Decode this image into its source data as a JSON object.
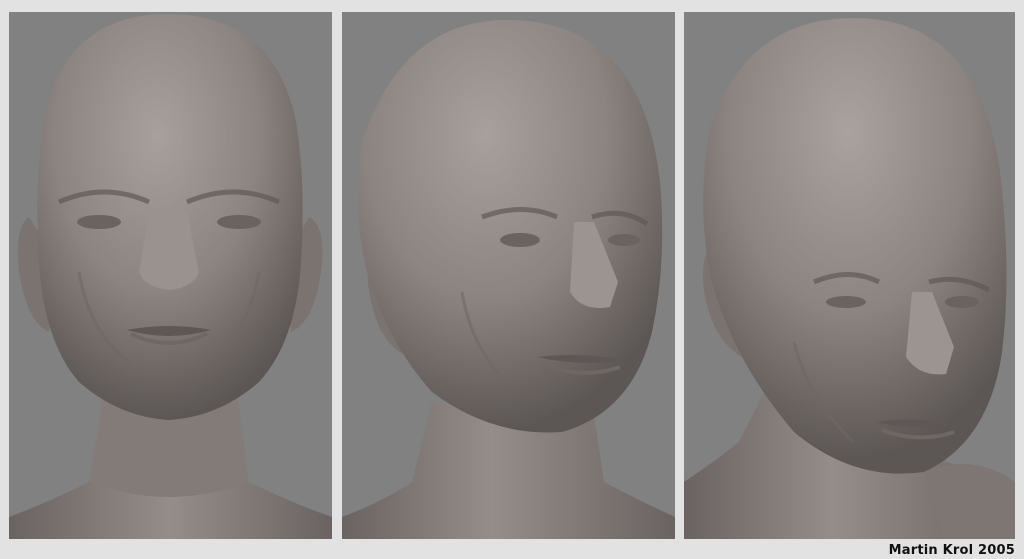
{
  "credit": {
    "text": "Martin Krol 2005"
  },
  "panels": [
    {
      "view": "front"
    },
    {
      "view": "three-quarter-right"
    },
    {
      "view": "three-quarter-down-right"
    }
  ],
  "colors": {
    "page_background": "#e2e2e2",
    "panel_background": "#818181",
    "skin_highlight": "#a49c98",
    "skin_mid": "#8a827e",
    "skin_shadow": "#5e5755",
    "credit_text": "#111111"
  }
}
